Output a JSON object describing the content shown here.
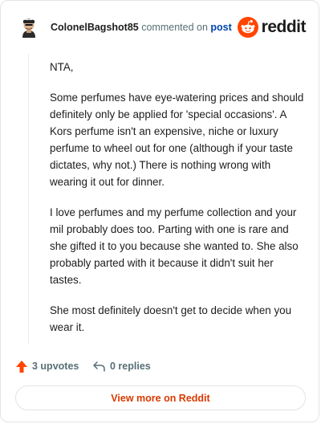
{
  "header": {
    "username": "ColonelBagshot85",
    "action_text": "commented on",
    "post_link": "post",
    "brand": "reddit"
  },
  "comment": {
    "paragraphs": [
      "NTA,",
      "Some perfumes have eye-watering prices and should definitely only be applied for 'special occasions'. A Kors perfume isn't an expensive, niche or luxury perfume to wheel out for one (although if your taste dictates, why not.) There is nothing wrong with wearing it out for dinner.",
      "I love perfumes and my perfume collection and your mil probably does too. Parting with one is rare and she gifted it to you because she wanted to. She also probably parted with it because it didn't suit her tastes.",
      "She most definitely doesn't get to decide when you wear it."
    ]
  },
  "actions": {
    "upvotes": "3 upvotes",
    "replies": "0 replies"
  },
  "footer": {
    "view_more": "View more on Reddit"
  },
  "colors": {
    "accent": "#ff4500",
    "link": "#0045ac",
    "view_more": "#d93a00"
  },
  "icons": {
    "avatar": "user-avatar-icon",
    "logo": "reddit-snoo-icon",
    "upvote": "upvote-arrow-icon",
    "reply": "reply-arrow-icon"
  }
}
